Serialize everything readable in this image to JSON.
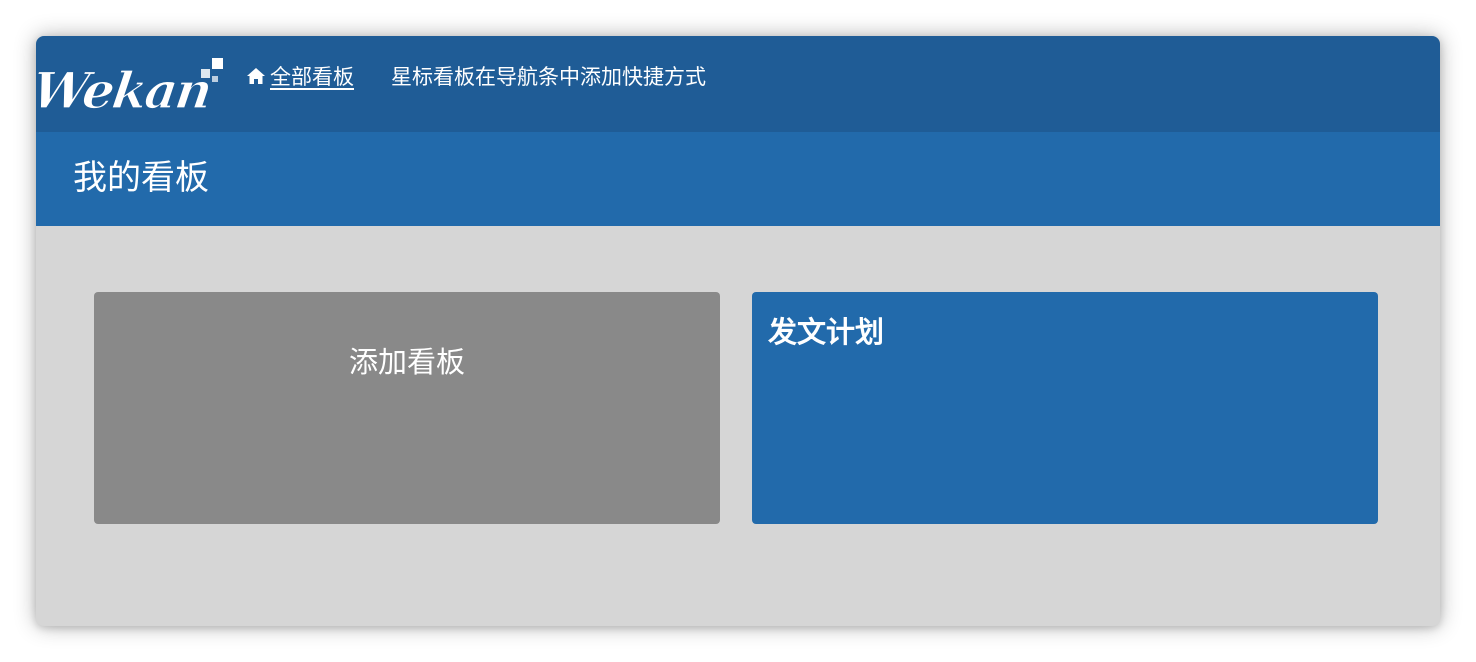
{
  "topbar": {
    "logo_text": "Wekan",
    "home_icon": "home-icon",
    "all_boards_label": "全部看板",
    "star_tip": "星标看板在导航条中添加快捷方式"
  },
  "header": {
    "title": "我的看板"
  },
  "boards": {
    "add_board_label": "添加看板",
    "items": [
      {
        "title": "发文计划",
        "color": "#226aab"
      }
    ]
  },
  "colors": {
    "topbar": "#1f5c96",
    "header": "#226aab",
    "canvas": "#d6d6d6",
    "add_tile": "#898989"
  }
}
